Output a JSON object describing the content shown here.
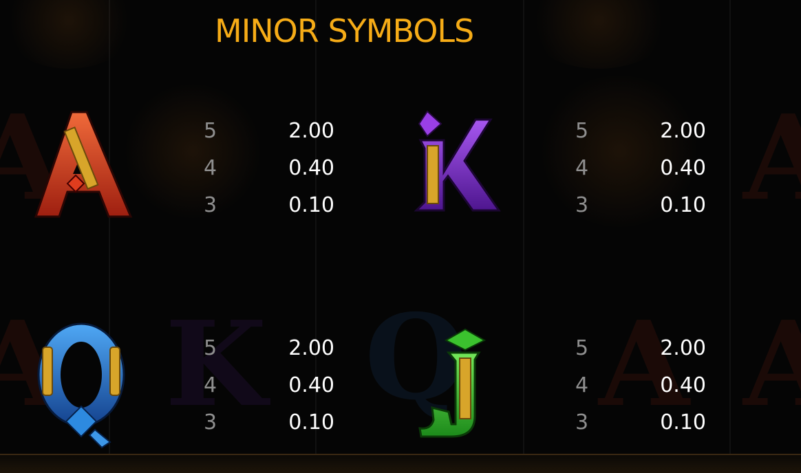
{
  "title": "MINOR SYMBOLS",
  "colors": {
    "title": "#f6ac17",
    "count": "#8f8f8f",
    "value": "#ffffff",
    "background": "#050505"
  },
  "symbols": [
    {
      "name": "A",
      "glyph": "A",
      "color": "#d63a1c",
      "pays": [
        {
          "count": "5",
          "value": "2.00"
        },
        {
          "count": "4",
          "value": "0.40"
        },
        {
          "count": "3",
          "value": "0.10"
        }
      ]
    },
    {
      "name": "K",
      "glyph": "K",
      "color": "#7a2fc4",
      "pays": [
        {
          "count": "5",
          "value": "2.00"
        },
        {
          "count": "4",
          "value": "0.40"
        },
        {
          "count": "3",
          "value": "0.10"
        }
      ]
    },
    {
      "name": "Q",
      "glyph": "Q",
      "color": "#2d7fd8",
      "pays": [
        {
          "count": "5",
          "value": "2.00"
        },
        {
          "count": "4",
          "value": "0.40"
        },
        {
          "count": "3",
          "value": "0.10"
        }
      ]
    },
    {
      "name": "J",
      "glyph": "J",
      "color": "#3bc22e",
      "pays": [
        {
          "count": "5",
          "value": "2.00"
        },
        {
          "count": "4",
          "value": "0.40"
        },
        {
          "count": "3",
          "value": "0.10"
        }
      ]
    }
  ]
}
